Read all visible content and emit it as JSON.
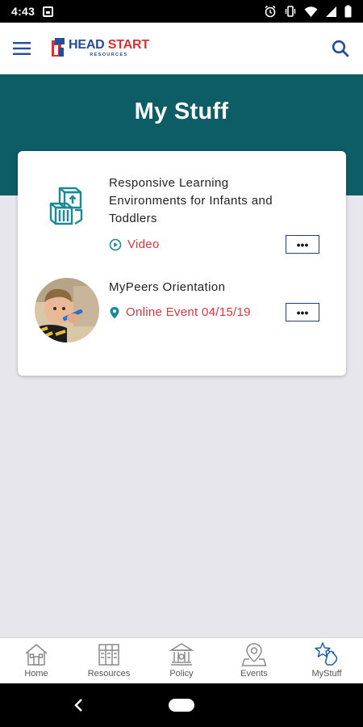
{
  "status_bar": {
    "time": "4:43",
    "icons": [
      "image-notification-icon",
      "alarm-icon",
      "vibrate-icon",
      "wifi-icon",
      "signal-icon",
      "battery-icon"
    ]
  },
  "app_bar": {
    "logo": {
      "title_part1": "HEAD",
      "title_part2": " START",
      "subtitle": "RESOURCES"
    },
    "icons": [
      "hamburger-menu-icon",
      "search-icon"
    ]
  },
  "header": {
    "title": "My Stuff",
    "background": "#0c5d66"
  },
  "items": [
    {
      "title": "Responsive Learning Environments for Infants and Toddlers",
      "meta": "Video",
      "meta_icon": "play-circle-icon",
      "thumb_icon": "blocks-icon",
      "more_label": "•••"
    },
    {
      "title": "MyPeers Orientation",
      "meta": "Online Event 04/15/19",
      "meta_icon": "location-pin-icon",
      "thumb_icon": "child-photo",
      "more_label": "•••"
    }
  ],
  "bottom_nav": [
    {
      "label": "Home",
      "icon": "home-icon"
    },
    {
      "label": "Resources",
      "icon": "resources-icon"
    },
    {
      "label": "Policy",
      "icon": "policy-building-icon"
    },
    {
      "label": "Events",
      "icon": "events-map-pin-icon"
    },
    {
      "label": "MyStuff",
      "icon": "mystuff-star-hand-icon",
      "active": true
    }
  ],
  "colors": {
    "accent_red": "#e2343c",
    "teal": "#0c5d66",
    "navy": "#2a3d73",
    "logo_red": "#d9303a",
    "logo_blue": "#234c9a"
  }
}
